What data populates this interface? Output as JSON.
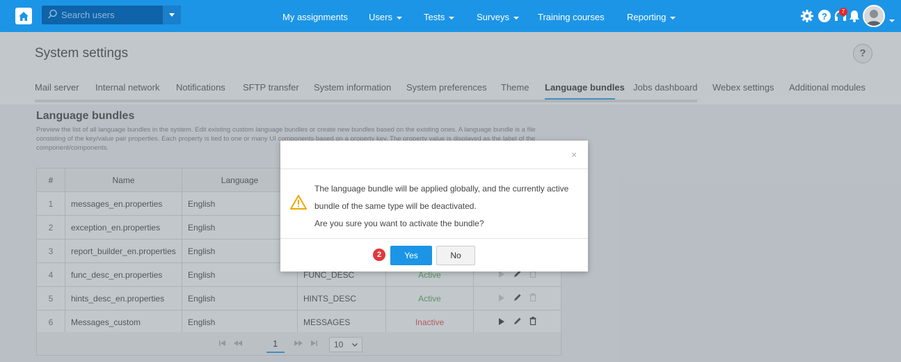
{
  "topbar": {
    "search_placeholder": "Search users",
    "nav": [
      "My assignments",
      "Users",
      "Tests",
      "Surveys",
      "Training courses",
      "Reporting"
    ],
    "notification_count": "7",
    "icons": [
      "home-icon",
      "search-icon",
      "gear-icon",
      "help-icon",
      "headset-icon",
      "bell-icon"
    ]
  },
  "page": {
    "title": "System settings",
    "help": "?",
    "tabs": [
      "Mail server",
      "Internal network",
      "Notifications",
      "SFTP transfer",
      "System information",
      "System preferences",
      "Theme",
      "Language bundles",
      "Jobs dashboard",
      "Webex settings",
      "Additional modules"
    ],
    "active_tab": "Language bundles"
  },
  "section": {
    "title": "Language bundles",
    "description": "Preview the list of all language bundles in the system. Edit existing custom language bundles or create new bundles based on the existing ones. A language bundle is a file consisting of the key/value pair properties. Each property is tied to one or many UI components based on a property key. The property value is displayed as the label of the component/components."
  },
  "table": {
    "headers": [
      "#",
      "Name",
      "Language",
      "",
      "",
      ""
    ],
    "rows": [
      {
        "num": "1",
        "name": "messages_en.properties",
        "language": "English",
        "key": "",
        "status": ""
      },
      {
        "num": "2",
        "name": "exception_en.properties",
        "language": "English",
        "key": "",
        "status": ""
      },
      {
        "num": "3",
        "name": "report_builder_en.properties",
        "language": "English",
        "key": "",
        "status": ""
      },
      {
        "num": "4",
        "name": "func_desc_en.properties",
        "language": "English",
        "key": "FUNC_DESC",
        "status": "Active"
      },
      {
        "num": "5",
        "name": "hints_desc_en.properties",
        "language": "English",
        "key": "HINTS_DESC",
        "status": "Active"
      },
      {
        "num": "6",
        "name": "Messages_custom",
        "language": "English",
        "key": "MESSAGES",
        "status": "Inactive"
      }
    ]
  },
  "pager": {
    "current_page": "1",
    "page_size": "10"
  },
  "modal": {
    "close": "×",
    "line1": "The language bundle will be applied globally, and the currently active",
    "line2": "bundle of the same type will be deactivated.",
    "line3": "Are you sure you want to activate the bundle?",
    "step": "2",
    "yes": "Yes",
    "no": "No"
  },
  "colors": {
    "brand": "#1c95e6",
    "active": "#49a148",
    "inactive": "#e0393e"
  }
}
